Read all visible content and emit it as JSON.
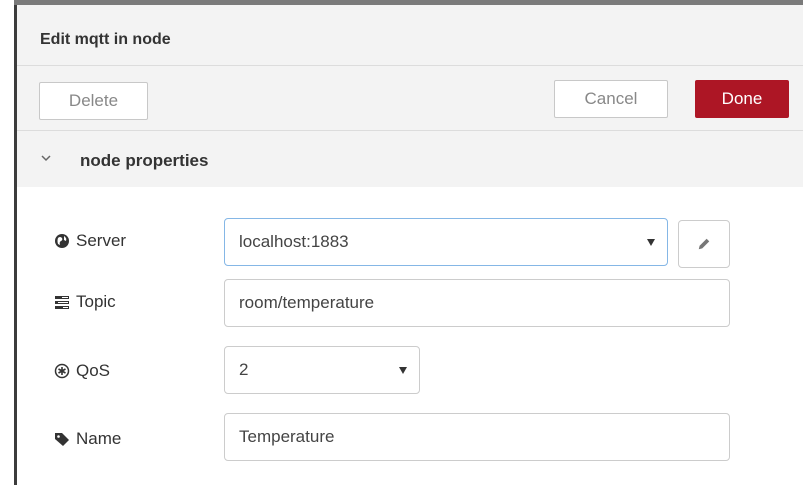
{
  "dialog": {
    "title": "Edit mqtt in node",
    "buttons": {
      "delete_label": "Delete",
      "cancel_label": "Cancel",
      "done_label": "Done"
    },
    "section": {
      "title": "node properties"
    }
  },
  "form": {
    "server": {
      "label": "Server",
      "value": "localhost:1883",
      "icon": "globe-icon"
    },
    "topic": {
      "label": "Topic",
      "value": "room/temperature",
      "icon": "tasks-icon"
    },
    "qos": {
      "label": "QoS",
      "value": "2",
      "icon": "asterisk-circle-icon"
    },
    "name": {
      "label": "Name",
      "value": "Temperature",
      "icon": "tag-icon"
    }
  },
  "colors": {
    "done_button": "#ad1625",
    "panel_background": "#f3f3f3",
    "focus_border": "#85b7e6"
  }
}
